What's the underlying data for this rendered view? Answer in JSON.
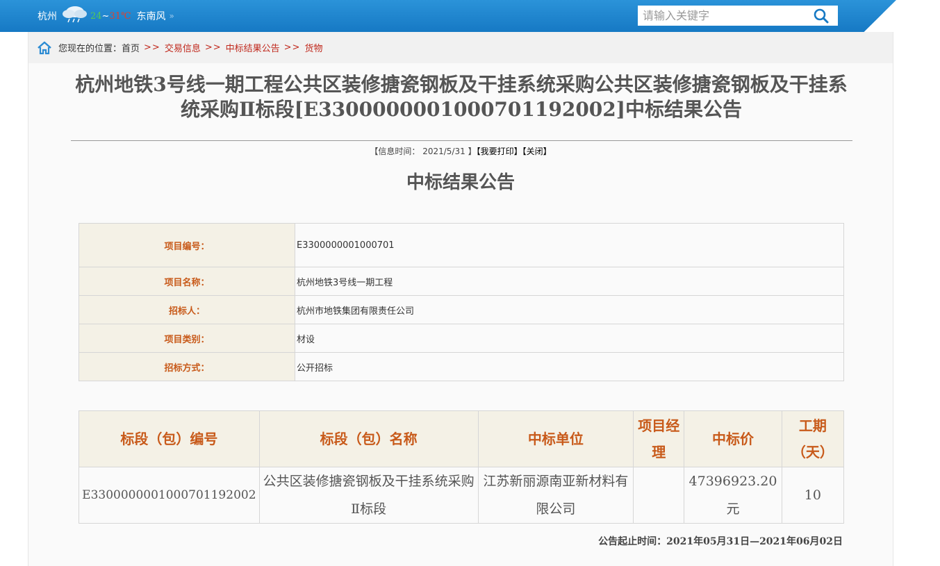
{
  "weather": {
    "city": "杭州",
    "temp_low": "24",
    "temp_sep": "~",
    "temp_high": "31℃",
    "wind": "东南风"
  },
  "search": {
    "placeholder": "请输入关键字"
  },
  "breadcrumb": {
    "prefix": "您现在的位置：",
    "items": [
      "首页",
      "交易信息",
      "中标结果公告",
      "货物"
    ],
    "separator": ">>"
  },
  "article": {
    "title": "杭州地铁3号线一期工程公共区装修搪瓷钢板及干挂系统采购公共区装修搪瓷钢板及干挂系统采购Ⅱ标段[E3300000001000701192002]中标结果公告",
    "meta_prefix": "【信息时间：",
    "meta_date": "2021/5/31",
    "meta_suffix": "】",
    "print_label": "【我要打印】",
    "close_label": "【关闭】",
    "subtitle": "中标结果公告"
  },
  "info_table": [
    {
      "label": "项目编号：",
      "value": "E3300000001000701"
    },
    {
      "label": "项目名称：",
      "value": "杭州地铁3号线一期工程"
    },
    {
      "label": "招标人：",
      "value": "杭州市地铁集团有限责任公司"
    },
    {
      "label": "项目类别：",
      "value": "材设"
    },
    {
      "label": "招标方式：",
      "value": "公开招标"
    }
  ],
  "result_table": {
    "headers": [
      "标段（包）编号",
      "标段（包）名称",
      "中标单位",
      "项目经理",
      "中标价",
      "工期（天）"
    ],
    "rows": [
      [
        "E3300000001000701192002",
        "公共区装修搪瓷钢板及干挂系统采购Ⅱ标段",
        "江苏新丽源南亚新材料有限公司",
        "",
        "47396923.20元",
        "10"
      ]
    ]
  },
  "deadline": {
    "label": "公告起止时间：",
    "value": "2021年05月31日—2021年06月02日"
  },
  "colors": {
    "topbar": "#1f86cf",
    "accent_red": "#c0281c",
    "label_orange": "#c85a1a",
    "label_bg": "#f4f1e6"
  },
  "icons": [
    "cloud-rain-icon",
    "double-arrow-icon",
    "search-icon",
    "home-icon"
  ]
}
